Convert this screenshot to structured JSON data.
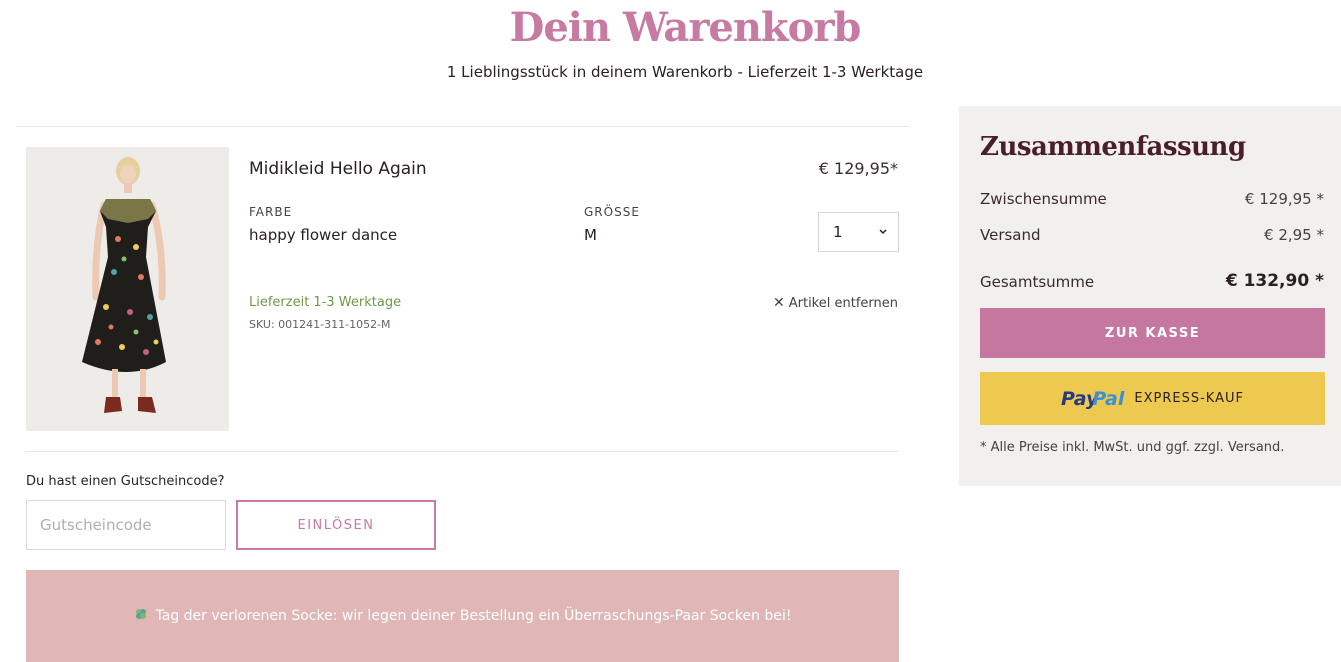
{
  "header": {
    "title": "Dein Warenkorb",
    "subtitle": "1 Lieblingsstück in deinem Warenkorb - Lieferzeit 1-3 Werktage"
  },
  "cart_item": {
    "name": "Midikleid Hello Again",
    "price": "€ 129,95*",
    "color_label": "FARBE",
    "color_value": "happy flower dance",
    "size_label": "GRÖSSE",
    "size_value": "M",
    "quantity": "1",
    "delivery": "Lieferzeit 1-3 Werktage",
    "sku_label": "SKU:",
    "sku_value": "001241-311-1052-M",
    "remove_label": "Artikel entfernen"
  },
  "voucher": {
    "question": "Du hast einen Gutscheincode?",
    "placeholder": "Gutscheincode",
    "button_label": "EINLÖSEN"
  },
  "banner": {
    "text": "Tag der verlorenen Socke: wir legen deiner Bestellung ein Überraschungs-Paar Socken bei!"
  },
  "summary": {
    "title": "Zusammenfassung",
    "subtotal_label": "Zwischensumme",
    "subtotal_value": "€ 129,95 *",
    "shipping_label": "Versand",
    "shipping_value": "€ 2,95 *",
    "total_label": "Gesamtsumme",
    "total_value": "€ 132,90 *",
    "checkout_label": "ZUR KASSE",
    "paypal_brand_a": "Pay",
    "paypal_brand_b": "Pal",
    "paypal_label": "EXPRESS-KAUF",
    "price_note": "* Alle Preise inkl. MwSt. und ggf. zzgl. Versand."
  },
  "colors": {
    "accent": "#c77aa2",
    "summary_bg": "#f1f0ec",
    "banner_bg": "#e0b6b7",
    "paypal_bg": "#eec94f",
    "delivery_green": "#6d9a48"
  },
  "icons": [
    "product-photo",
    "chevron-down-icon",
    "close-icon",
    "clover-icon",
    "paypal-logo"
  ]
}
